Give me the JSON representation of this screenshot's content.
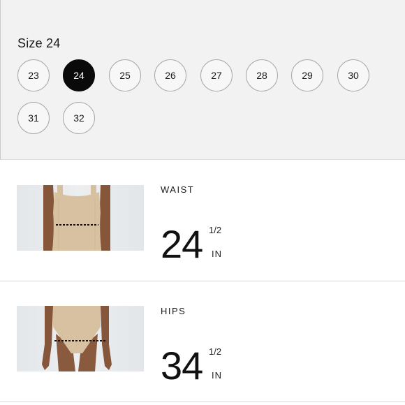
{
  "size_selector": {
    "title": "Size 24",
    "selected": "24",
    "options": [
      "23",
      "24",
      "25",
      "26",
      "27",
      "28",
      "29",
      "30",
      "31",
      "32"
    ]
  },
  "measurements": [
    {
      "label": "WAIST",
      "value": "24",
      "fraction": "1/2",
      "unit": "IN"
    },
    {
      "label": "HIPS",
      "value": "34",
      "fraction": "1/2",
      "unit": "IN"
    }
  ],
  "colors": {
    "panel_bg": "#f2f2f2",
    "selected_fill": "#0a0a0a",
    "option_border": "#a9a9a9",
    "skin": "#8a5a3e",
    "garment": "#d7c1a0"
  }
}
